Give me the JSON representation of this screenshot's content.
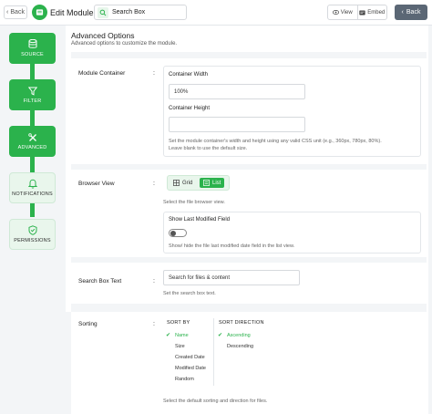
{
  "topbar": {
    "back_label": "Back",
    "title": "Edit Module",
    "module_name": "Search Box",
    "view_label": "View",
    "embed_label": "Embed",
    "back2_label": "Back"
  },
  "steps": [
    {
      "label": "SOURCE",
      "state": "done",
      "icon": "database-icon"
    },
    {
      "label": "FILTER",
      "state": "done",
      "icon": "filter-icon"
    },
    {
      "label": "ADVANCED",
      "state": "done",
      "icon": "tools-icon"
    },
    {
      "label": "NOTIFICATIONS",
      "state": "todo",
      "icon": "bell-icon"
    },
    {
      "label": "PERMISSIONS",
      "state": "todo",
      "icon": "shield-check-icon"
    }
  ],
  "header": {
    "title": "Advanced Options",
    "subtitle": "Advanced options to customize the module."
  },
  "module_container": {
    "label": "Module Container",
    "width_label": "Container Width",
    "width_value": "100%",
    "height_label": "Container Height",
    "height_value": "",
    "help_line1": "Set the module container's width and height using any valid CSS unit (e.g., 360px, 780px, 80%).",
    "help_line2": "Leave blank to use the default size."
  },
  "browser_view": {
    "label": "Browser View",
    "grid_label": "Grid",
    "list_label": "List",
    "selected": "List",
    "help": "Select the file browser view.",
    "last_modified_label": "Show Last Modified Field",
    "last_modified_on": false,
    "last_modified_help": "Show/ hide the file last modified date field in the list view."
  },
  "search_box": {
    "label": "Search Box Text",
    "value": "Search for files & content",
    "help": "Set the search box text."
  },
  "sorting": {
    "label": "Sorting",
    "sort_by_heading": "SORT BY",
    "sort_by": [
      "Name",
      "Size",
      "Created Date",
      "Modified Date",
      "Random"
    ],
    "sort_by_selected": "Name",
    "direction_heading": "SORT DIRECTION",
    "direction": [
      "Ascending",
      "Descending"
    ],
    "direction_selected": "Ascending",
    "help": "Select the default sorting and direction for files."
  },
  "colors": {
    "accent": "#2bb24c",
    "accent_light": "#e9f6ec",
    "dark_button": "#5b6775"
  }
}
